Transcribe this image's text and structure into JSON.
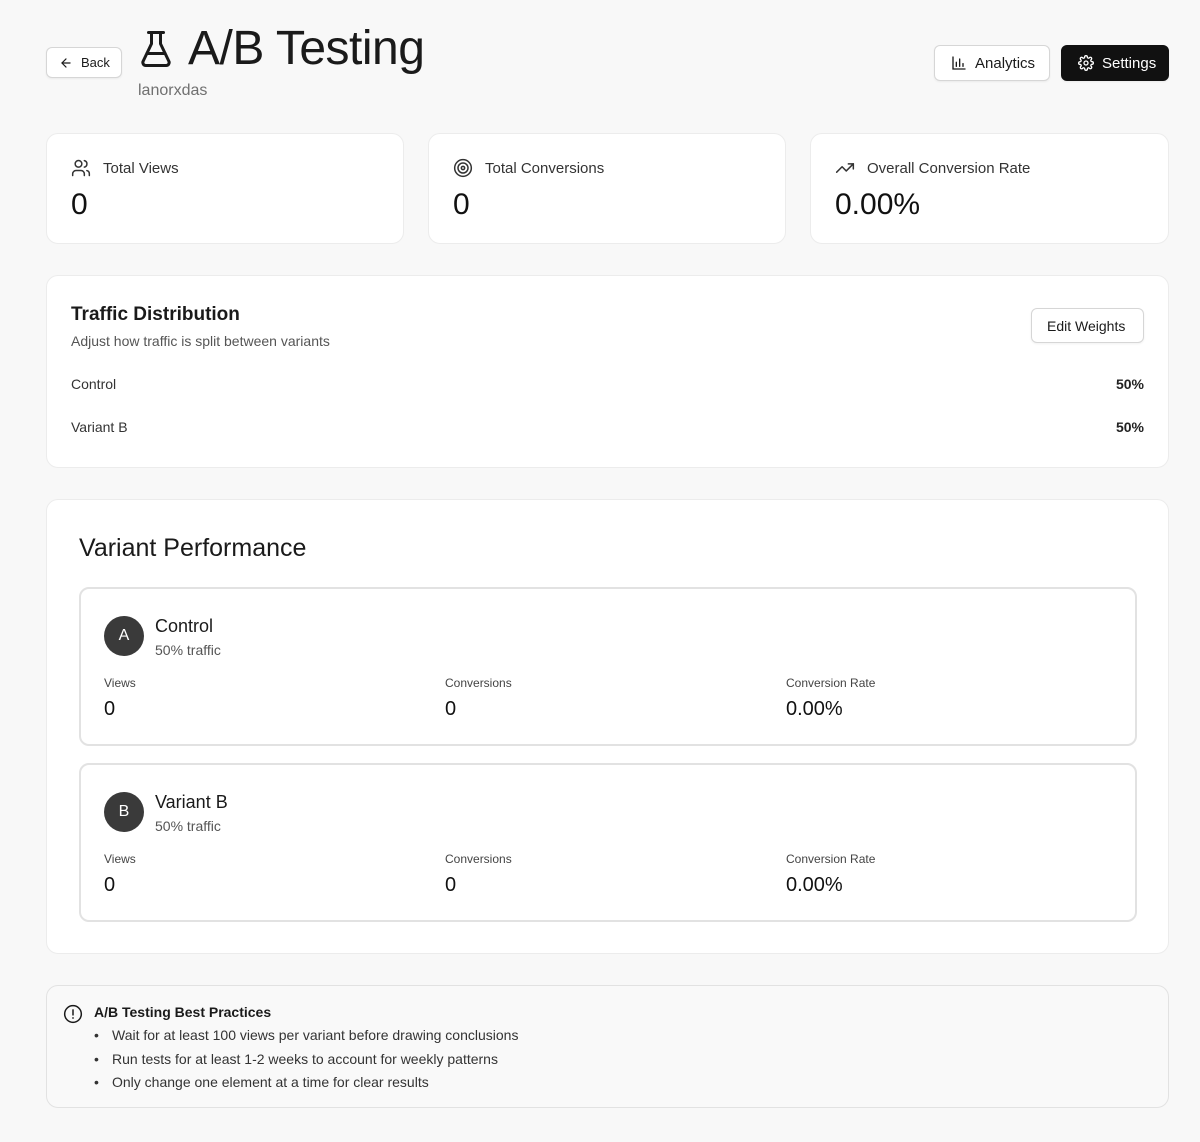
{
  "header": {
    "back_label": "Back",
    "title": "A/B Testing",
    "subtitle": "lanorxdas",
    "analytics_label": "Analytics",
    "settings_label": "Settings"
  },
  "stats": [
    {
      "label": "Total Views",
      "value": "0",
      "icon": "users-icon"
    },
    {
      "label": "Total Conversions",
      "value": "0",
      "icon": "target-icon"
    },
    {
      "label": "Overall Conversion Rate",
      "value": "0.00%",
      "icon": "trending-up-icon"
    }
  ],
  "traffic": {
    "title": "Traffic Distribution",
    "description": "Adjust how traffic is split between variants",
    "edit_label": "Edit Weights",
    "rows": [
      {
        "name": "Control",
        "percent": "50%"
      },
      {
        "name": "Variant B",
        "percent": "50%"
      }
    ]
  },
  "performance": {
    "title": "Variant Performance",
    "variants": [
      {
        "letter": "A",
        "name": "Control",
        "traffic": "50% traffic",
        "views_label": "Views",
        "views": "0",
        "conversions_label": "Conversions",
        "conversions": "0",
        "rate_label": "Conversion Rate",
        "rate": "0.00%"
      },
      {
        "letter": "B",
        "name": "Variant B",
        "traffic": "50% traffic",
        "views_label": "Views",
        "views": "0",
        "conversions_label": "Conversions",
        "conversions": "0",
        "rate_label": "Conversion Rate",
        "rate": "0.00%"
      }
    ]
  },
  "tips": {
    "title": "A/B Testing Best Practices",
    "items": [
      "Wait for at least 100 views per variant before drawing conclusions",
      "Run tests for at least 1-2 weeks to account for weekly patterns",
      "Only change one element at a time for clear results"
    ]
  },
  "colors": {
    "background": "#f8f8f8",
    "primary_button": "#111111",
    "avatar": "#3a3a3a"
  }
}
